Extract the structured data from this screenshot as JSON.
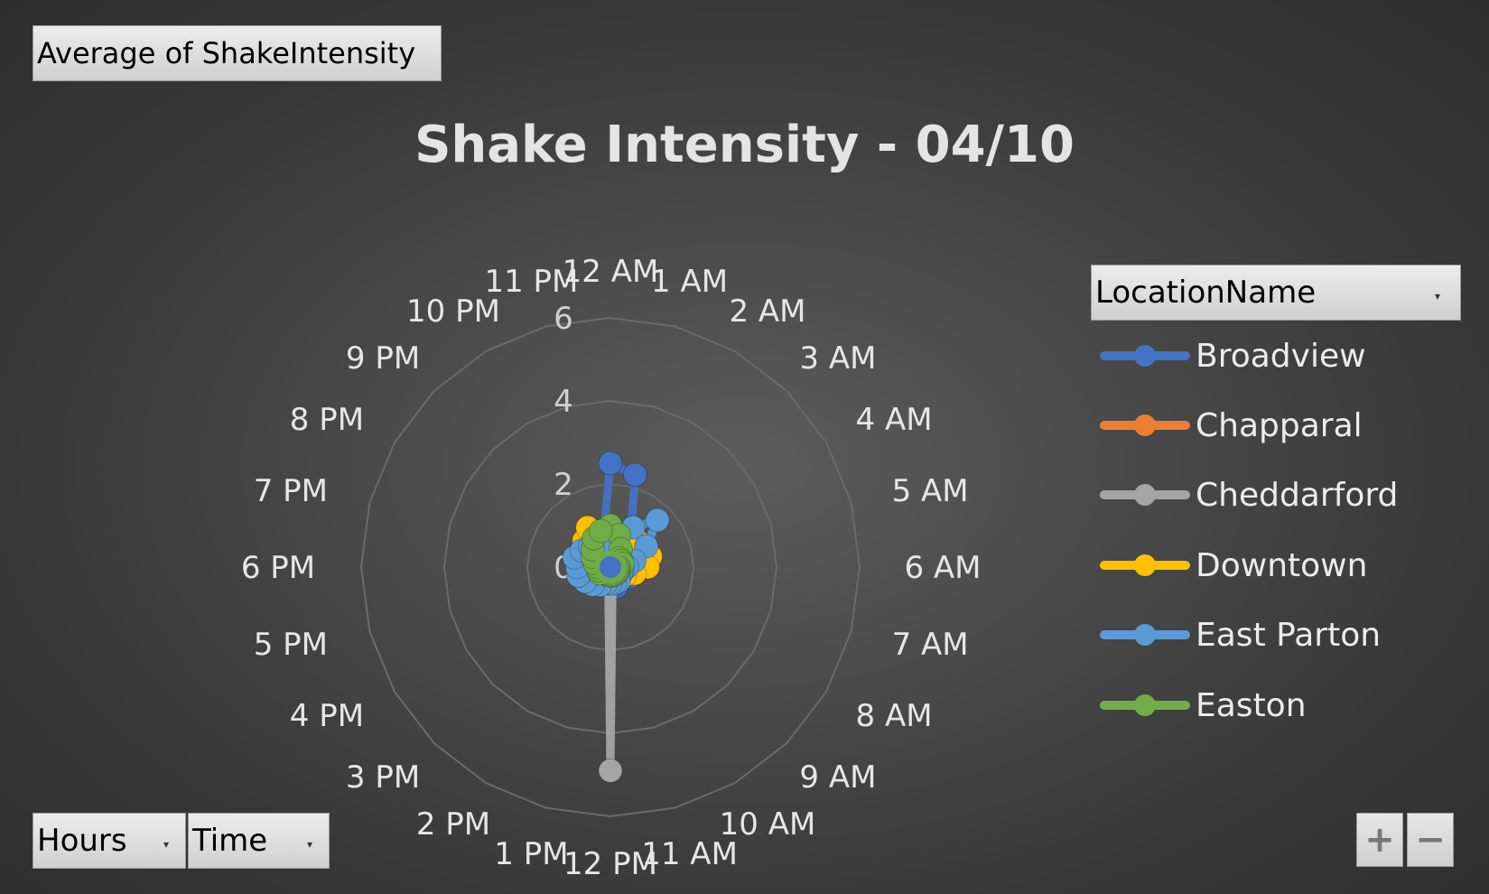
{
  "pivot": {
    "measure_label": "Average of ShakeIntensity",
    "axis_fields": [
      {
        "label": "Hours",
        "icon": "dropdown-arrow-icon"
      },
      {
        "label": "Time",
        "icon": "dropdown-arrow-icon"
      }
    ],
    "legend_field": {
      "label": "LocationName",
      "icon": "dropdown-arrow-icon"
    }
  },
  "zoom": {
    "in_label": "+",
    "out_label": "−"
  },
  "colors": {
    "Broadview": "#4472C4",
    "Chapparal": "#ED7D31",
    "Cheddarford": "#A5A5A5",
    "Downtown": "#FFC000",
    "East Parton": "#5B9BD5",
    "Easton": "#70AD47",
    "grid": "#6a6a6a",
    "label": "#e6e6e6",
    "tick": "#d0d0d0"
  },
  "chart_data": {
    "type": "radar",
    "title": "Shake Intensity - 04/10",
    "categories": [
      "12 AM",
      "1 AM",
      "2 AM",
      "3 AM",
      "4 AM",
      "5 AM",
      "6 AM",
      "7 AM",
      "8 AM",
      "9 AM",
      "10 AM",
      "11 AM",
      "12 PM",
      "1 PM",
      "2 PM",
      "3 PM",
      "4 PM",
      "5 PM",
      "6 PM",
      "7 PM",
      "8 PM",
      "9 PM",
      "10 PM",
      "11 PM"
    ],
    "rlim": [
      0,
      6
    ],
    "rticks": [
      "0",
      "2",
      "4",
      "6"
    ],
    "grid": true,
    "legend_position": "right",
    "series": [
      {
        "name": "Broadview",
        "values": [
          2.5,
          2.3,
          1.0,
          0.8,
          0.6,
          0.9,
          0.8,
          0.6,
          0.5,
          0.4,
          0.4,
          0.5,
          0.5,
          0.4,
          0.4,
          0.4,
          0.5,
          0.5,
          0.6,
          0.6,
          0.5,
          0.6,
          0.6,
          0.7
        ]
      },
      {
        "name": "Chapparal",
        "values": [
          0.2,
          0.2,
          0.2,
          0.2,
          0.2,
          0.2,
          0.2,
          0.2,
          0.3,
          0.3,
          0.3,
          0.3,
          0.3,
          0.3,
          0.3,
          0.3,
          0.2,
          0.2,
          0.2,
          0.2,
          0.2,
          0.2,
          0.2,
          0.2
        ]
      },
      {
        "name": "Cheddarford",
        "values": [
          0.3,
          0.3,
          0.2,
          0.2,
          0.2,
          0.2,
          0.2,
          0.2,
          0.2,
          0.2,
          0.2,
          0.2,
          4.9,
          0.2,
          0.2,
          0.2,
          0.2,
          0.2,
          0.2,
          0.2,
          0.2,
          0.2,
          0.2,
          0.3
        ]
      },
      {
        "name": "Downtown",
        "values": [
          0.5,
          0.6,
          0.7,
          0.9,
          1.0,
          1.0,
          0.9,
          0.6,
          0.4,
          0.3,
          0.3,
          0.3,
          0.3,
          0.3,
          0.3,
          0.3,
          0.4,
          0.4,
          0.5,
          0.6,
          0.7,
          0.9,
          1.1,
          0.6
        ]
      },
      {
        "name": "East Parton",
        "values": [
          0.4,
          0.5,
          1.1,
          1.6,
          1.0,
          0.6,
          0.4,
          0.3,
          0.3,
          0.3,
          0.4,
          0.4,
          0.4,
          0.4,
          0.5,
          0.6,
          0.7,
          0.8,
          0.8,
          0.9,
          0.8,
          0.7,
          0.6,
          0.5
        ]
      },
      {
        "name": "Easton",
        "values": [
          1.0,
          0.8,
          0.5,
          0.3,
          0.3,
          0.3,
          0.2,
          0.2,
          0.2,
          0.2,
          0.2,
          0.2,
          0.2,
          0.2,
          0.2,
          0.2,
          0.3,
          0.3,
          0.3,
          0.4,
          0.5,
          0.6,
          0.8,
          0.9
        ]
      }
    ]
  }
}
